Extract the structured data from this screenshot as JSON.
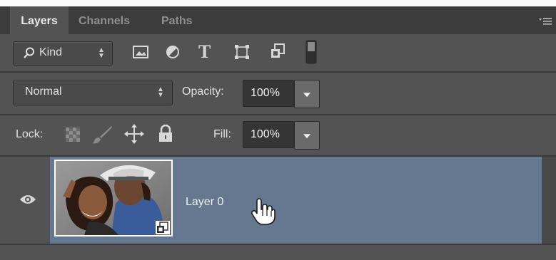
{
  "tabs": [
    {
      "label": "Layers",
      "active": true
    },
    {
      "label": "Channels",
      "active": false
    },
    {
      "label": "Paths",
      "active": false
    }
  ],
  "panel_menu_icon": "panel-menu-icon",
  "filter": {
    "kind_label": "Kind",
    "icons": [
      "image-filter-icon",
      "adjustment-filter-icon",
      "type-filter-icon",
      "shape-filter-icon",
      "smart-object-filter-icon",
      "filter-toggle-icon"
    ]
  },
  "blend": {
    "mode": "Normal",
    "opacity_label": "Opacity:",
    "opacity_value": "100%"
  },
  "lock": {
    "label": "Lock:",
    "icons": [
      "lock-transparent-pixels-icon",
      "lock-image-pixels-icon",
      "lock-position-icon",
      "lock-all-icon"
    ],
    "fill_label": "Fill:",
    "fill_value": "100%"
  },
  "layers": [
    {
      "name": "Layer 0",
      "visible": true,
      "selected": true,
      "smart_object": true
    }
  ],
  "colors": {
    "panel_bg": "#535353",
    "tab_bar_bg": "#3c3c3c",
    "selected_layer": "#66788f",
    "field_bg": "#353535"
  }
}
